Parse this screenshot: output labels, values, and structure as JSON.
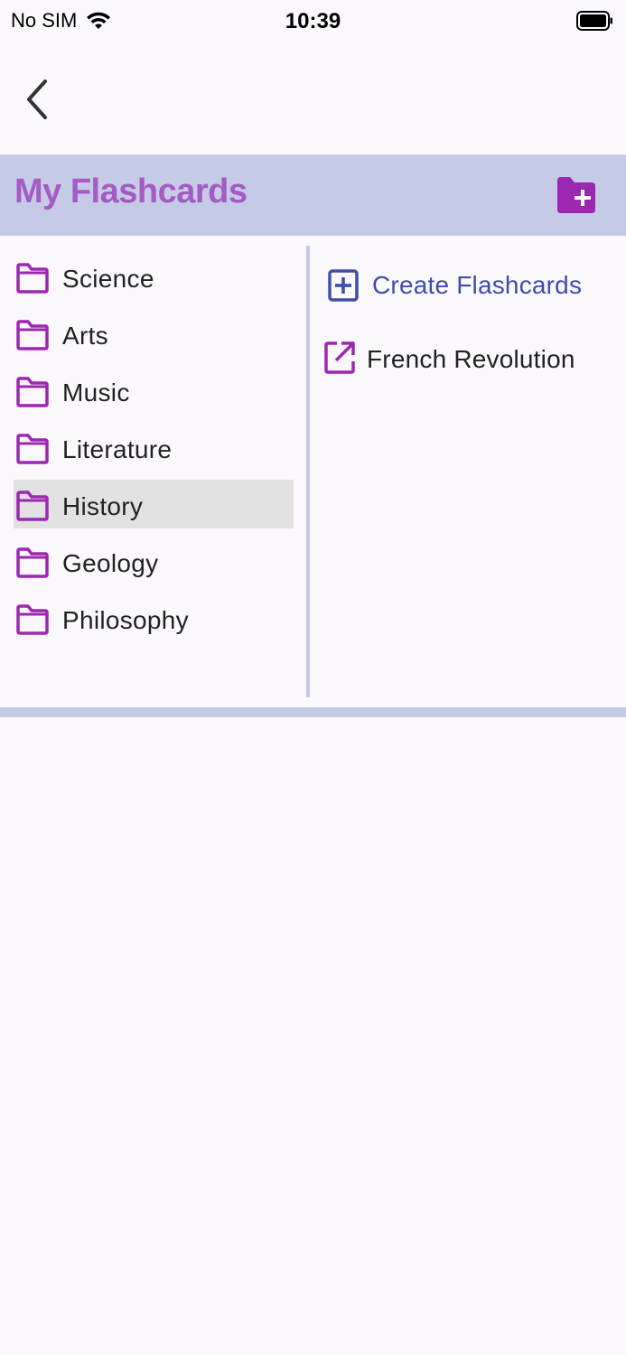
{
  "status_bar": {
    "carrier": "No SIM",
    "time": "10:39"
  },
  "header": {
    "title": "My Flashcards"
  },
  "folders": [
    {
      "label": "Science",
      "selected": false
    },
    {
      "label": "Arts",
      "selected": false
    },
    {
      "label": "Music",
      "selected": false
    },
    {
      "label": "Literature",
      "selected": false
    },
    {
      "label": "History",
      "selected": true
    },
    {
      "label": "Geology",
      "selected": false
    },
    {
      "label": "Philosophy",
      "selected": false
    }
  ],
  "detail": {
    "create_label": "Create Flashcards",
    "decks": [
      {
        "label": "French Revolution"
      }
    ]
  },
  "colors": {
    "background": "#FCF9FE",
    "header_bg": "#C5CAE6",
    "title": "#A55BC4",
    "folder_icon": "#9C27B0",
    "create": "#3F4DAB",
    "selected_bg": "#E2E2E2"
  },
  "icons": {
    "back": "chevron-left-icon",
    "new_folder": "folder-plus-icon",
    "folder": "folder-outline-icon",
    "create": "add-box-icon",
    "open_deck": "open-in-new-icon"
  }
}
